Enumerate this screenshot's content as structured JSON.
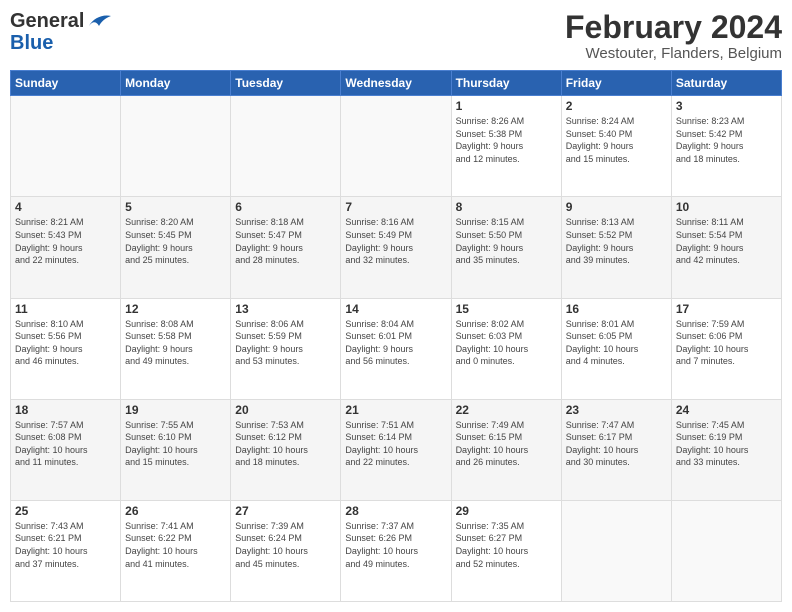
{
  "logo": {
    "general": "General",
    "blue": "Blue"
  },
  "title": "February 2024",
  "subtitle": "Westouter, Flanders, Belgium",
  "days_header": [
    "Sunday",
    "Monday",
    "Tuesday",
    "Wednesday",
    "Thursday",
    "Friday",
    "Saturday"
  ],
  "weeks": [
    [
      {
        "day": "",
        "info": ""
      },
      {
        "day": "",
        "info": ""
      },
      {
        "day": "",
        "info": ""
      },
      {
        "day": "",
        "info": ""
      },
      {
        "day": "1",
        "info": "Sunrise: 8:26 AM\nSunset: 5:38 PM\nDaylight: 9 hours\nand 12 minutes."
      },
      {
        "day": "2",
        "info": "Sunrise: 8:24 AM\nSunset: 5:40 PM\nDaylight: 9 hours\nand 15 minutes."
      },
      {
        "day": "3",
        "info": "Sunrise: 8:23 AM\nSunset: 5:42 PM\nDaylight: 9 hours\nand 18 minutes."
      }
    ],
    [
      {
        "day": "4",
        "info": "Sunrise: 8:21 AM\nSunset: 5:43 PM\nDaylight: 9 hours\nand 22 minutes."
      },
      {
        "day": "5",
        "info": "Sunrise: 8:20 AM\nSunset: 5:45 PM\nDaylight: 9 hours\nand 25 minutes."
      },
      {
        "day": "6",
        "info": "Sunrise: 8:18 AM\nSunset: 5:47 PM\nDaylight: 9 hours\nand 28 minutes."
      },
      {
        "day": "7",
        "info": "Sunrise: 8:16 AM\nSunset: 5:49 PM\nDaylight: 9 hours\nand 32 minutes."
      },
      {
        "day": "8",
        "info": "Sunrise: 8:15 AM\nSunset: 5:50 PM\nDaylight: 9 hours\nand 35 minutes."
      },
      {
        "day": "9",
        "info": "Sunrise: 8:13 AM\nSunset: 5:52 PM\nDaylight: 9 hours\nand 39 minutes."
      },
      {
        "day": "10",
        "info": "Sunrise: 8:11 AM\nSunset: 5:54 PM\nDaylight: 9 hours\nand 42 minutes."
      }
    ],
    [
      {
        "day": "11",
        "info": "Sunrise: 8:10 AM\nSunset: 5:56 PM\nDaylight: 9 hours\nand 46 minutes."
      },
      {
        "day": "12",
        "info": "Sunrise: 8:08 AM\nSunset: 5:58 PM\nDaylight: 9 hours\nand 49 minutes."
      },
      {
        "day": "13",
        "info": "Sunrise: 8:06 AM\nSunset: 5:59 PM\nDaylight: 9 hours\nand 53 minutes."
      },
      {
        "day": "14",
        "info": "Sunrise: 8:04 AM\nSunset: 6:01 PM\nDaylight: 9 hours\nand 56 minutes."
      },
      {
        "day": "15",
        "info": "Sunrise: 8:02 AM\nSunset: 6:03 PM\nDaylight: 10 hours\nand 0 minutes."
      },
      {
        "day": "16",
        "info": "Sunrise: 8:01 AM\nSunset: 6:05 PM\nDaylight: 10 hours\nand 4 minutes."
      },
      {
        "day": "17",
        "info": "Sunrise: 7:59 AM\nSunset: 6:06 PM\nDaylight: 10 hours\nand 7 minutes."
      }
    ],
    [
      {
        "day": "18",
        "info": "Sunrise: 7:57 AM\nSunset: 6:08 PM\nDaylight: 10 hours\nand 11 minutes."
      },
      {
        "day": "19",
        "info": "Sunrise: 7:55 AM\nSunset: 6:10 PM\nDaylight: 10 hours\nand 15 minutes."
      },
      {
        "day": "20",
        "info": "Sunrise: 7:53 AM\nSunset: 6:12 PM\nDaylight: 10 hours\nand 18 minutes."
      },
      {
        "day": "21",
        "info": "Sunrise: 7:51 AM\nSunset: 6:14 PM\nDaylight: 10 hours\nand 22 minutes."
      },
      {
        "day": "22",
        "info": "Sunrise: 7:49 AM\nSunset: 6:15 PM\nDaylight: 10 hours\nand 26 minutes."
      },
      {
        "day": "23",
        "info": "Sunrise: 7:47 AM\nSunset: 6:17 PM\nDaylight: 10 hours\nand 30 minutes."
      },
      {
        "day": "24",
        "info": "Sunrise: 7:45 AM\nSunset: 6:19 PM\nDaylight: 10 hours\nand 33 minutes."
      }
    ],
    [
      {
        "day": "25",
        "info": "Sunrise: 7:43 AM\nSunset: 6:21 PM\nDaylight: 10 hours\nand 37 minutes."
      },
      {
        "day": "26",
        "info": "Sunrise: 7:41 AM\nSunset: 6:22 PM\nDaylight: 10 hours\nand 41 minutes."
      },
      {
        "day": "27",
        "info": "Sunrise: 7:39 AM\nSunset: 6:24 PM\nDaylight: 10 hours\nand 45 minutes."
      },
      {
        "day": "28",
        "info": "Sunrise: 7:37 AM\nSunset: 6:26 PM\nDaylight: 10 hours\nand 49 minutes."
      },
      {
        "day": "29",
        "info": "Sunrise: 7:35 AM\nSunset: 6:27 PM\nDaylight: 10 hours\nand 52 minutes."
      },
      {
        "day": "",
        "info": ""
      },
      {
        "day": "",
        "info": ""
      }
    ]
  ]
}
